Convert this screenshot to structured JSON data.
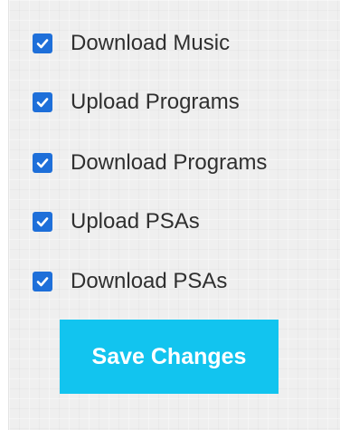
{
  "permissions": {
    "items": [
      {
        "label": "Download Music",
        "checked": true
      },
      {
        "label": "Upload Programs",
        "checked": true
      },
      {
        "label": "Download Programs",
        "checked": true
      },
      {
        "label": "Upload PSAs",
        "checked": true
      },
      {
        "label": "Download PSAs",
        "checked": true
      }
    ]
  },
  "actions": {
    "save_label": "Save Changes"
  },
  "colors": {
    "checkbox": "#1e6fd9",
    "button": "#12c4ef",
    "button_text": "#ffffff",
    "label_text": "#2f2f2f"
  },
  "icons": {
    "checkbox_checked": "checkmark-icon"
  }
}
